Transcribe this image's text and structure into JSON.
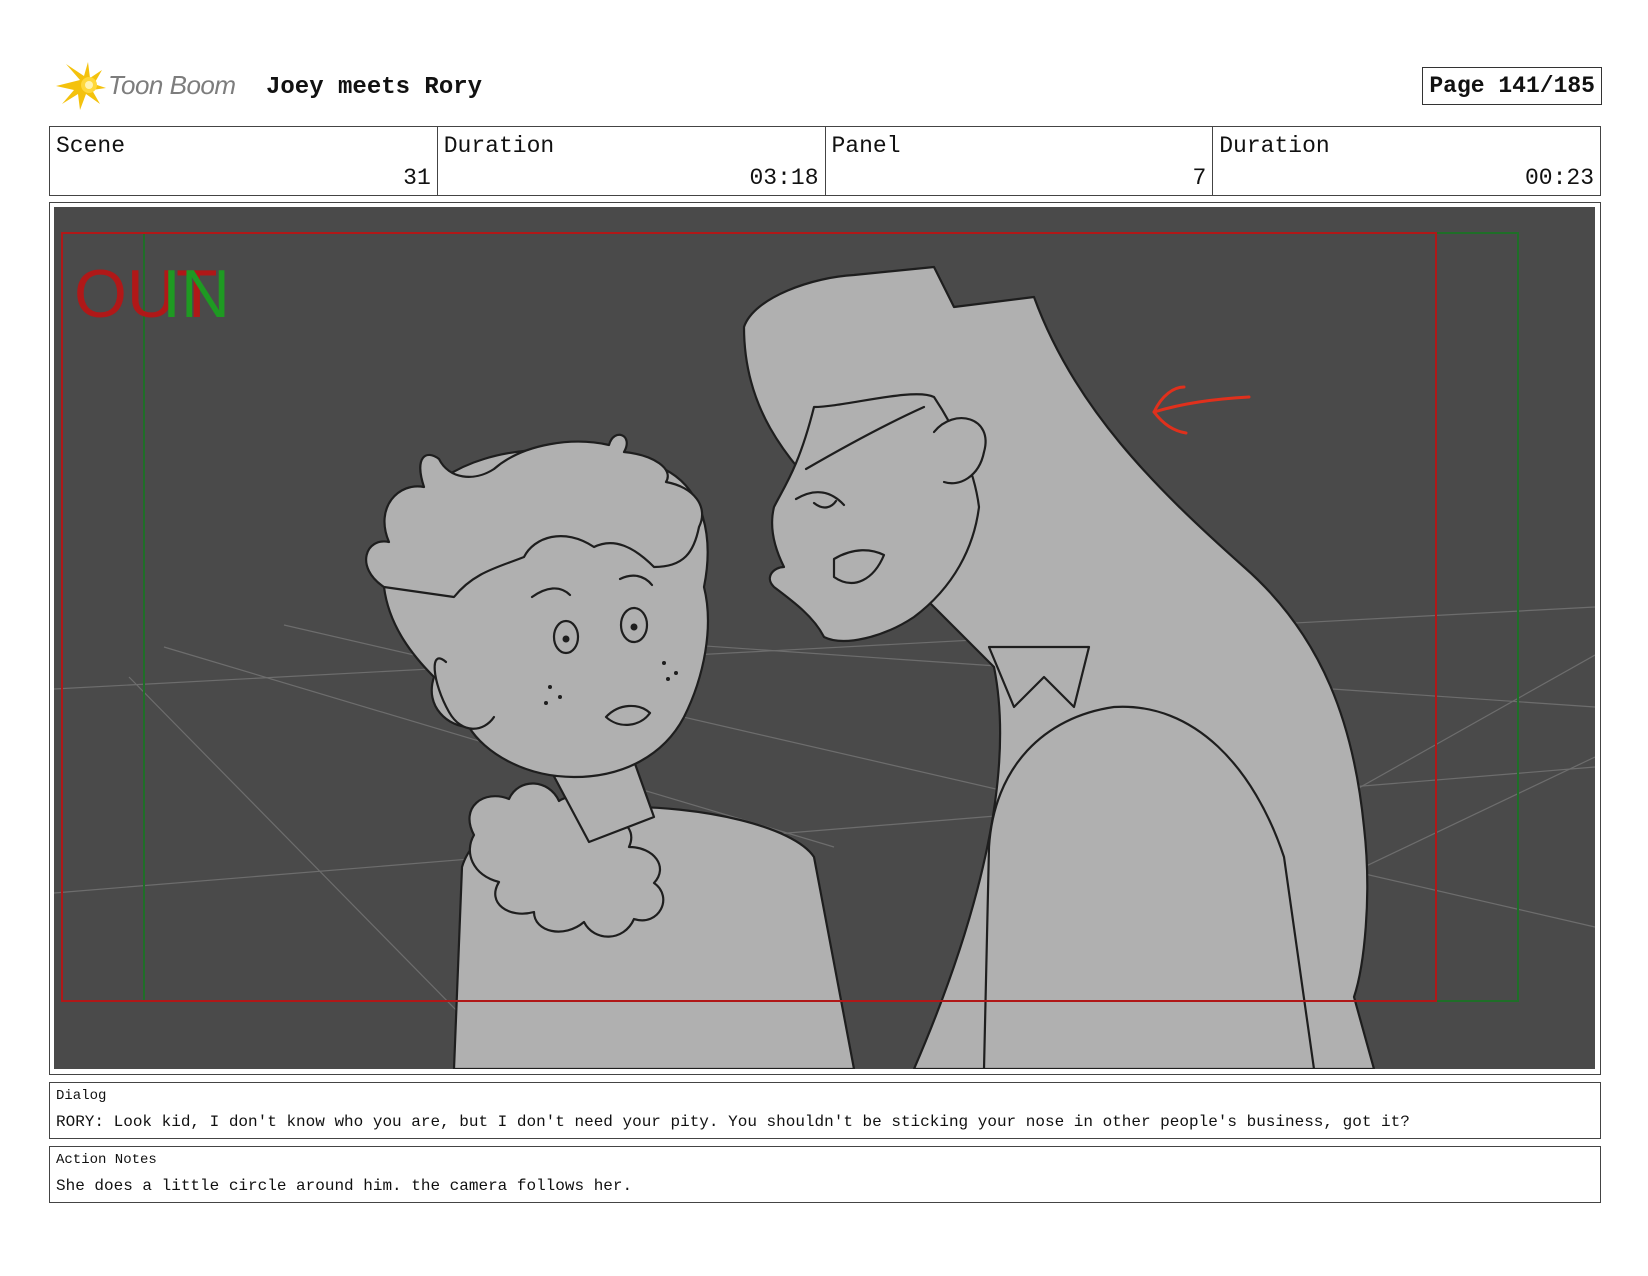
{
  "header": {
    "logo_text": "Toon Boom",
    "project_title": "Joey meets Rory",
    "page_label": "Page 141/185"
  },
  "meta": {
    "scene_label": "Scene",
    "scene_value": "31",
    "scene_duration_label": "Duration",
    "scene_duration_value": "03:18",
    "panel_label": "Panel",
    "panel_value": "7",
    "panel_duration_label": "Duration",
    "panel_duration_value": "00:23"
  },
  "panel": {
    "out_marker": "OUT",
    "in_marker": "IN",
    "colors": {
      "background": "#4a4a4a",
      "character_fill": "#b0b0b0",
      "out_frame": "#b01818",
      "in_frame": "#1f6e28",
      "arrow": "#e0301c"
    }
  },
  "dialog": {
    "label": "Dialog",
    "text": "RORY: Look kid, I don't know who you are, but I don't need your pity. You shouldn't be sticking your nose in other people's business, got it?"
  },
  "action_notes": {
    "label": "Action Notes",
    "text": "She does a little circle around him. the camera follows her."
  }
}
